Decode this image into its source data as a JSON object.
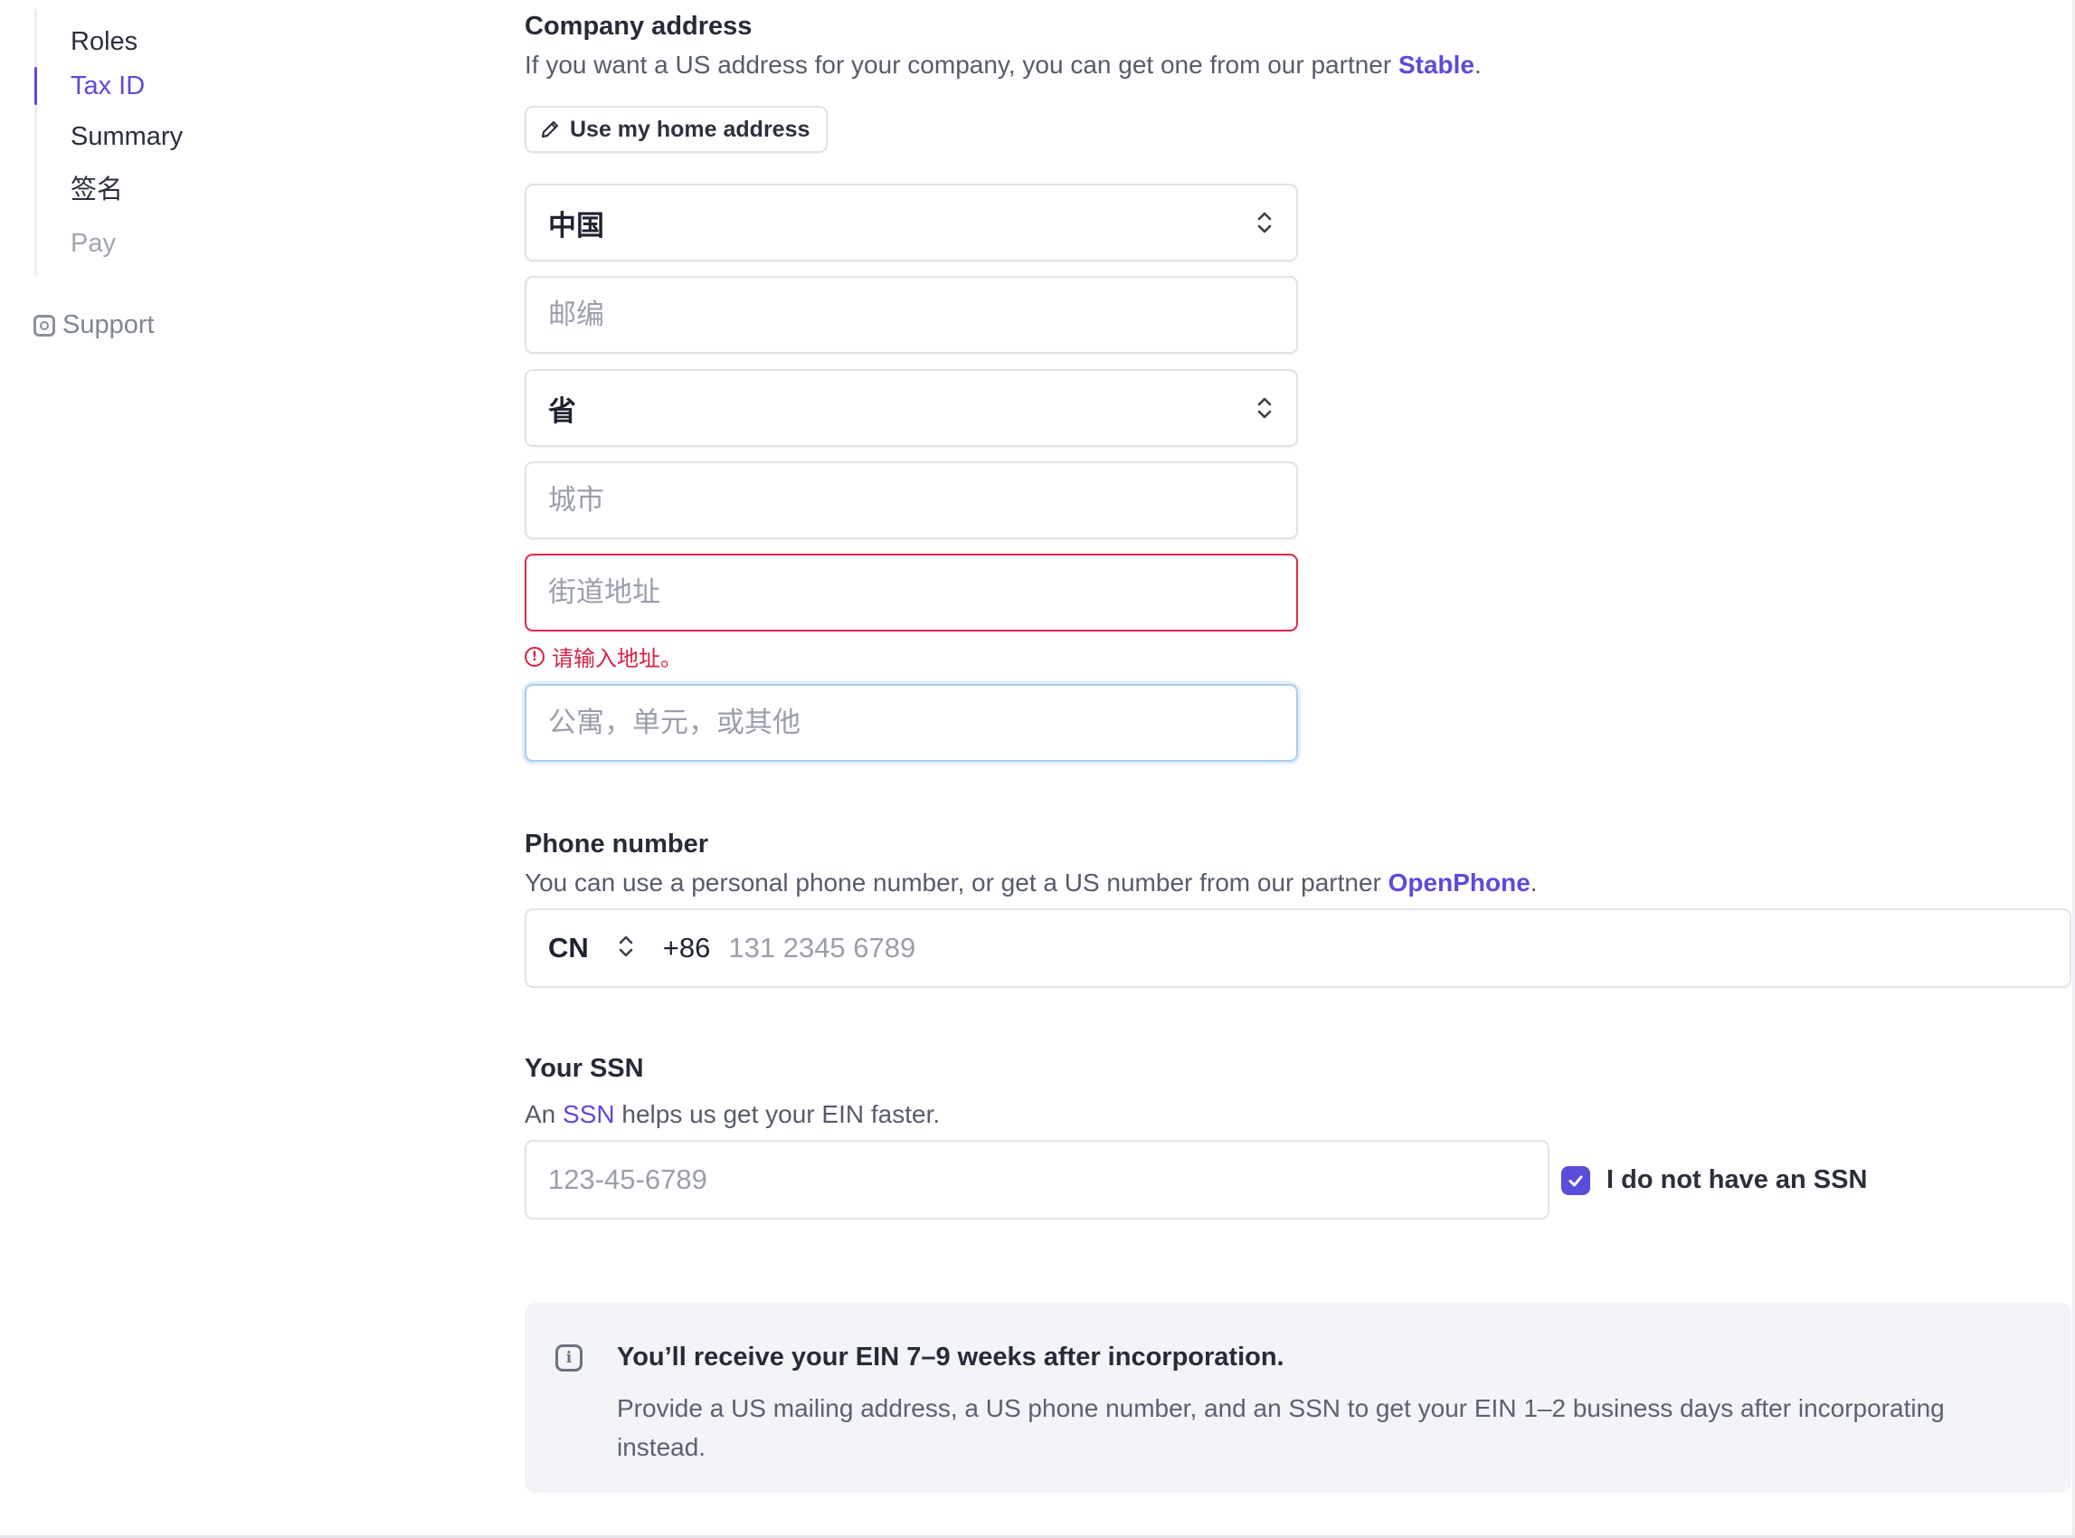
{
  "sidebar": {
    "items": [
      {
        "label": "Roles"
      },
      {
        "label": "Tax ID"
      },
      {
        "label": "Summary"
      },
      {
        "label": "签名"
      },
      {
        "label": "Pay"
      }
    ],
    "support_label": "Support"
  },
  "company_address": {
    "title": "Company address",
    "desc_prefix": "If you want a US address for your company, you can get one from our partner ",
    "partner_link": "Stable",
    "desc_suffix": ".",
    "home_button_label": "Use my home address",
    "country_value": "中国",
    "postal_placeholder": "邮编",
    "province_value": "省",
    "city_placeholder": "城市",
    "street_placeholder": "街道地址",
    "street_error": "请输入地址。",
    "apartment_placeholder": "公寓，单元，或其他"
  },
  "phone": {
    "title": "Phone number",
    "desc_prefix": "You can use a personal phone number, or get a US number from our partner ",
    "partner_link": "OpenPhone",
    "desc_suffix": ".",
    "country": "CN",
    "dial_code": "+86",
    "placeholder": "131 2345 6789"
  },
  "ssn": {
    "title": "Your SSN",
    "desc_prefix": "An ",
    "desc_link": "SSN",
    "desc_suffix": " helps us get your EIN faster.",
    "placeholder": "123-45-6789",
    "no_ssn_label": "I do not have an SSN",
    "no_ssn_checked": true
  },
  "info": {
    "title": "You’ll receive your EIN 7–9 weeks after incorporation.",
    "body": "Provide a US mailing address, a US phone number, and an SSN to get your EIN 1–2 business days after incorporating instead."
  },
  "colors": {
    "accent": "#5b4cdb",
    "error": "#e0264a",
    "focus": "#a9cdef"
  }
}
